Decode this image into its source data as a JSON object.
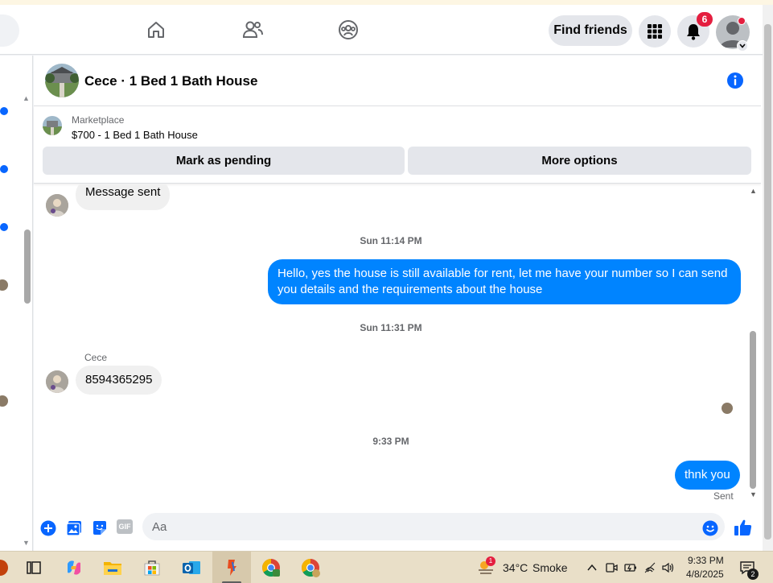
{
  "header": {
    "find_friends_label": "Find friends",
    "notification_count": "6"
  },
  "chat": {
    "title": "Cece · 1 Bed 1 Bath House",
    "marketplace": {
      "label": "Marketplace",
      "listing": "$700 - 1 Bed 1 Bath House",
      "pending_label": "Mark as pending",
      "more_label": "More options"
    },
    "messages": [
      {
        "type": "incoming",
        "text": "Message sent"
      },
      {
        "type": "time",
        "text": "Sun 11:14 PM"
      },
      {
        "type": "outgoing",
        "text": "Hello, yes the house is still available for rent, let me have your number so I can send you details and the requirements about the house"
      },
      {
        "type": "time",
        "text": "Sun 11:31 PM"
      },
      {
        "type": "sender",
        "text": "Cece"
      },
      {
        "type": "incoming",
        "text": "8594365295"
      },
      {
        "type": "time",
        "text": "9:33 PM"
      },
      {
        "type": "outgoing",
        "text": "thnk you"
      },
      {
        "type": "status",
        "text": "Sent"
      }
    ],
    "composer": {
      "placeholder": "Aa",
      "gif_label": "GIF"
    }
  },
  "taskbar": {
    "weather_temp": "34°C",
    "weather_text": "Smoke",
    "weather_badge": "1",
    "time": "9:33 PM",
    "date": "4/8/2025",
    "notification_count": "2"
  },
  "colors": {
    "accent": "#0866ff",
    "outgoing_bubble": "#0084ff",
    "incoming_bubble": "#f0f0f0",
    "badge_red": "#e41e3f"
  }
}
